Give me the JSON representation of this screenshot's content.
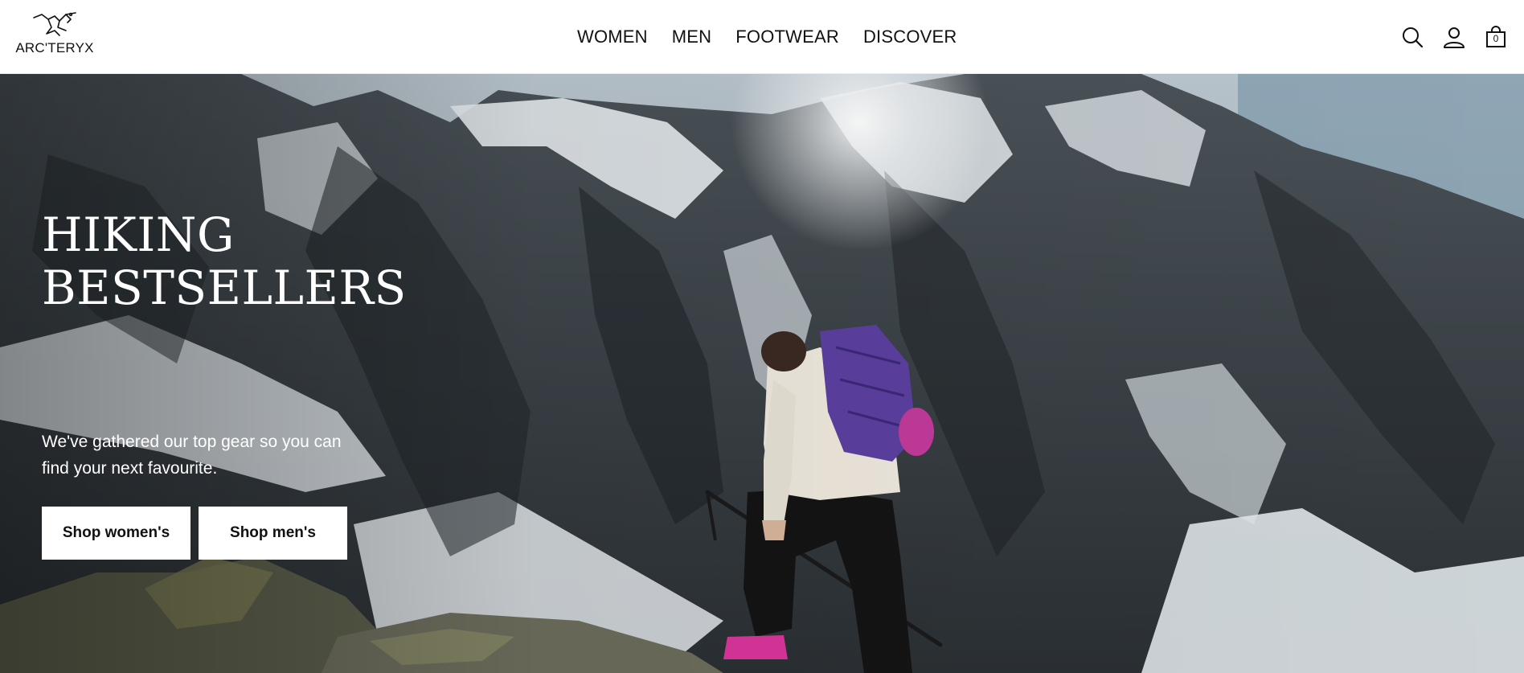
{
  "brand": {
    "name": "ARC'TERYX",
    "logo_icon": "archaeopteryx-logo-icon"
  },
  "nav": {
    "items": [
      {
        "label": "WOMEN"
      },
      {
        "label": "MEN"
      },
      {
        "label": "FOOTWEAR"
      },
      {
        "label": "DISCOVER"
      }
    ]
  },
  "utility": {
    "search_icon": "search-icon",
    "account_icon": "account-icon",
    "cart_icon": "shopping-bag-icon",
    "cart_count": "0"
  },
  "hero": {
    "title_line1": "HIKING",
    "title_line2": "BESTSELLERS",
    "subtitle_line1": "We've gathered our top gear so you can",
    "subtitle_line2": "find your next favourite.",
    "cta_women": "Shop women's",
    "cta_men": "Shop men's"
  },
  "colors": {
    "header_bg": "#ffffff",
    "text": "#111111",
    "hero_text": "#ffffff",
    "button_bg": "#ffffff",
    "backpack_accent": "#5b3fa0"
  }
}
